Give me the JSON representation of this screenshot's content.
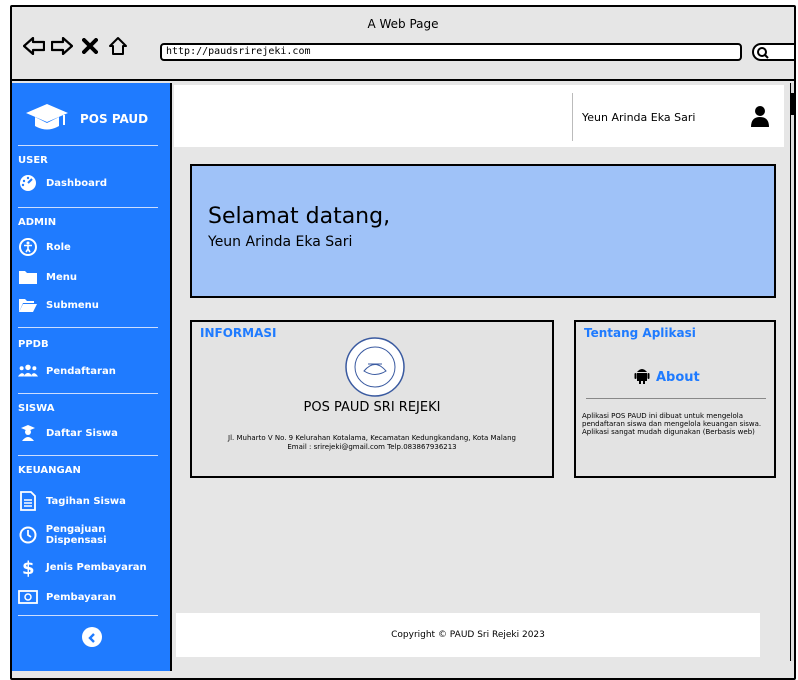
{
  "browser": {
    "title": "A Web Page",
    "url": "http://paudsrirejeki.com",
    "icons": [
      "back-arrow-icon",
      "forward-arrow-icon",
      "close-icon",
      "home-icon",
      "search-icon"
    ]
  },
  "sidebar": {
    "brand": "POS PAUD",
    "sections": [
      {
        "heading": "USER",
        "items": [
          {
            "label": "Dashboard",
            "icon": "dashboard-gauge-icon"
          }
        ]
      },
      {
        "heading": "ADMIN",
        "items": [
          {
            "label": "Role",
            "icon": "accessibility-icon"
          },
          {
            "label": "Menu",
            "icon": "folder-icon"
          },
          {
            "label": "Submenu",
            "icon": "folder-open-icon"
          }
        ]
      },
      {
        "heading": "PPDB",
        "items": [
          {
            "label": "Pendaftaran",
            "icon": "users-icon"
          }
        ]
      },
      {
        "heading": "SISWA",
        "items": [
          {
            "label": "Daftar Siswa",
            "icon": "student-icon"
          }
        ]
      },
      {
        "heading": "KEUANGAN",
        "items": [
          {
            "label": "Tagihan Siswa",
            "icon": "document-icon"
          },
          {
            "label": "Pengajuan Dispensasi",
            "icon": "clock-icon"
          },
          {
            "label": "Jenis Pembayaran",
            "icon": "dollar-icon"
          },
          {
            "label": "Pembayaran",
            "icon": "money-icon"
          }
        ]
      }
    ]
  },
  "topbar": {
    "user_name": "Yeun Arinda Eka Sari"
  },
  "welcome": {
    "title": "Selamat datang,",
    "name": "Yeun Arinda Eka Sari"
  },
  "info": {
    "heading": "INFORMASI",
    "school_name": "POS PAUD SRI REJEKI",
    "address": "Jl. Muharto V No. 9 Kelurahan Kotalama, Kecamatan Kedungkandang, Kota Malang",
    "contact": "Email : srirejeki@gmail.com Telp.083867936213"
  },
  "about": {
    "heading": "Tentang Aplikasi",
    "link": "About",
    "description": "Aplikasi POS PAUD ini dibuat untuk mengelola pendaftaran siswa dan mengelola keuangan siswa. Aplikasi sangat mudah digunakan (Berbasis web)"
  },
  "footer": {
    "copyright": "Copyright © PAUD Sri Rejeki 2023"
  },
  "colors": {
    "sidebar": "#1f7bff",
    "welcome_bg": "#9fc2f8",
    "card_bg": "#e3e3e3",
    "accent": "#1f7bff"
  }
}
